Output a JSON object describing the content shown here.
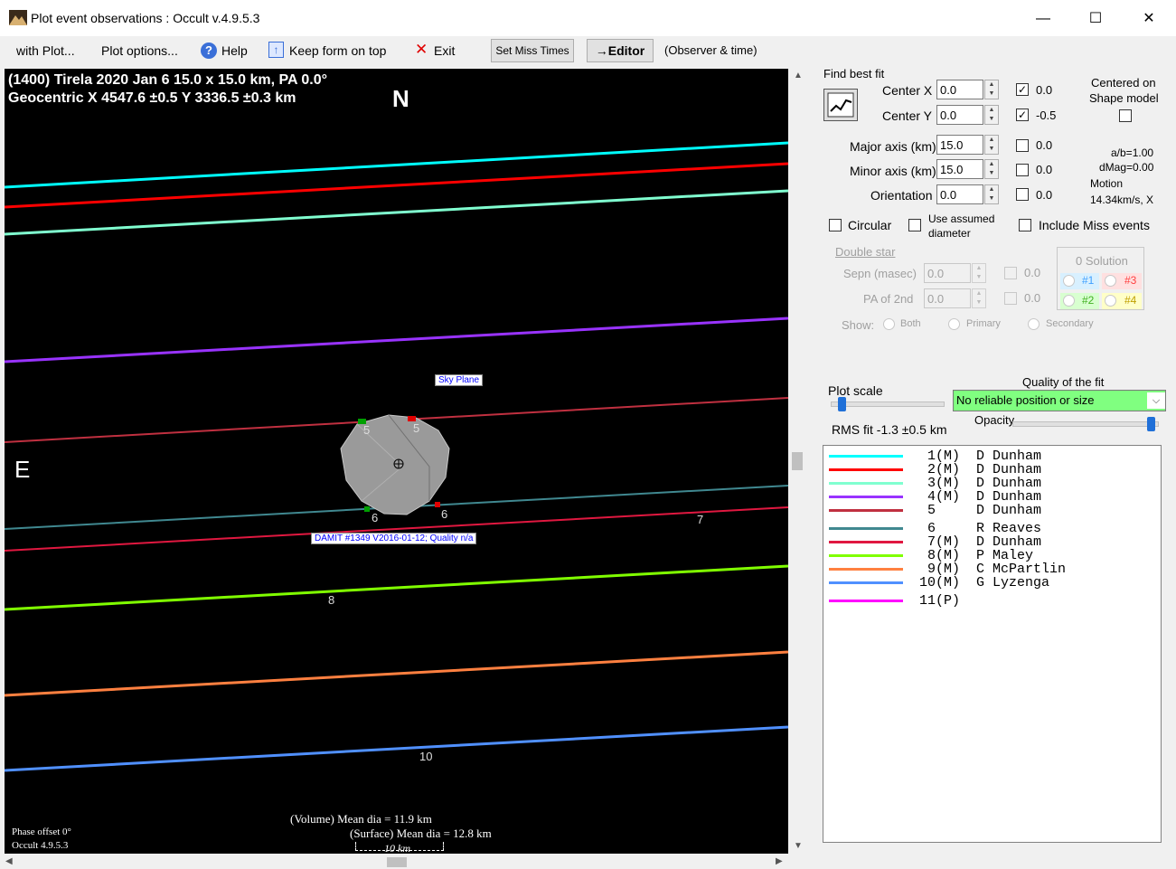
{
  "window": {
    "title": "Plot event observations : Occult v.4.9.5.3",
    "minimize": "—",
    "maximize": "☐",
    "close": "✕"
  },
  "menu": {
    "with_plot": "with Plot...",
    "plot_options": "Plot options...",
    "help": "Help",
    "keep_on_top": "Keep form on top",
    "exit": "Exit",
    "set_miss_times": "Set Miss Times",
    "editor": "→Editor",
    "observer_time": "(Observer & time)"
  },
  "canvas": {
    "header_line1": "(1400) Tirela  2020 Jan 6   15.0 x 15.0 km, PA 0.0°",
    "header_line2": "Geocentric  X  4547.6 ±0.5  Y 3336.5 ±0.3 km",
    "north": "N",
    "east": "E",
    "sky_plane": "Sky Plane",
    "damit": "DAMIT #1349 V2016-01-12; Quality n/a",
    "phase_offset": "Phase offset 0°",
    "version": "Occult 4.9.5.3",
    "vol_dia": "(Volume) Mean dia = 11.9 km",
    "surf_dia": "(Surface) Mean dia = 12.8 km",
    "scale": "10 km",
    "chord_labels": [
      "5",
      "5",
      "6",
      "6",
      "7",
      "8",
      "10"
    ]
  },
  "fit": {
    "find_best_fit": "Find best fit",
    "center_x_label": "Center X",
    "center_x": "0.0",
    "center_x_chk": "0.0",
    "center_y_label": "Center Y",
    "center_y": "0.0",
    "center_y_chk": "-0.5",
    "major_label": "Major axis (km)",
    "major": "15.0",
    "major_chk": "0.0",
    "minor_label": "Minor axis (km)",
    "minor": "15.0",
    "minor_chk": "0.0",
    "orient_label": "Orientation",
    "orient": "0.0",
    "orient_chk": "0.0",
    "centered_line1": "Centered on",
    "centered_line2": "Shape model",
    "ab": "a/b=1.00",
    "dmag": "dMag=0.00",
    "motion": "Motion",
    "motion_val": "14.34km/s, X",
    "circular": "Circular",
    "use_assumed1": "Use assumed",
    "use_assumed2": "diameter",
    "include_miss": "Include Miss events"
  },
  "double_star": {
    "title": "Double star",
    "sepn_label": "Sepn (masec)",
    "sepn": "0.0",
    "sepn_chk": "0.0",
    "pa_label": "PA of 2nd",
    "pa": "0.0",
    "pa_chk": "0.0",
    "show": "Show:",
    "both": "Both",
    "primary": "Primary",
    "secondary": "Secondary",
    "solution_title": "0 Solution",
    "sol1": "#1",
    "sol2": "#2",
    "sol3": "#3",
    "sol4": "#4"
  },
  "plot": {
    "plot_scale": "Plot scale",
    "quality_label": "Quality of the fit",
    "quality_value": "No reliable position or size",
    "opacity": "Opacity",
    "rms": "RMS fit -1.3 ±0.5 km",
    "plot_scale_level": 0.06,
    "opacity_level": 0.98
  },
  "observers": [
    {
      "text": " 1(M)  D Dunham",
      "color": "#00ffff"
    },
    {
      "text": " 2(M)  D Dunham",
      "color": "#ff0000"
    },
    {
      "text": " 3(M)  D Dunham",
      "color": "#80ffd0"
    },
    {
      "text": " 4(M)  D Dunham",
      "color": "#9933ff"
    },
    {
      "text": " 5     D Dunham",
      "color": "#c03040"
    },
    {
      "text": " 6     R Reaves",
      "color": "#408890"
    },
    {
      "text": " 7(M)  D Dunham",
      "color": "#e01840"
    },
    {
      "text": " 8(M)  P Maley",
      "color": "#80ff00"
    },
    {
      "text": " 9(M)  C McPartlin",
      "color": "#ff8040"
    },
    {
      "text": "10(M)  G Lyzenga",
      "color": "#5090ff"
    },
    {
      "text": "11(P)",
      "color": "#ff00ff"
    }
  ]
}
